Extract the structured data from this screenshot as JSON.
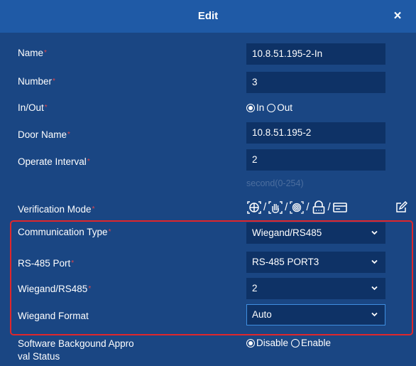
{
  "dialog": {
    "title": "Edit",
    "close_symbol": "×"
  },
  "fields": {
    "name": {
      "label": "Name",
      "required_mark": "*",
      "value": "10.8.51.195-2-In"
    },
    "number": {
      "label": "Number",
      "required_mark": "*",
      "value": "3"
    },
    "in_out": {
      "label": "In/Out",
      "required_mark": "*",
      "option_in": "In",
      "option_out": "Out",
      "selected": "In"
    },
    "door_name": {
      "label": "Door Name",
      "required_mark": "*",
      "value": "10.8.51.195-2"
    },
    "operate_interval": {
      "label": "Operate Interval",
      "required_mark": "*",
      "value": "2",
      "hint": "second(0-254)"
    },
    "verification_mode": {
      "label": "Verification Mode",
      "required_mark": "*",
      "separator": "/",
      "icons": [
        "face-icon",
        "palm-icon",
        "fingerprint-icon",
        "password-icon",
        "card-icon"
      ]
    },
    "communication_type": {
      "label": "Communication Type",
      "required_mark": "*",
      "value": "Wiegand/RS485"
    },
    "rs485_port": {
      "label": "RS-485 Port",
      "required_mark": "*",
      "value": "RS-485 PORT3"
    },
    "wiegand_rs485": {
      "label": "Wiegand/RS485",
      "required_mark": "*",
      "value": "2"
    },
    "wiegand_format": {
      "label": "Wiegand Format",
      "value": "Auto"
    },
    "software_background_approval": {
      "label_line1": "Software Backgound Appro",
      "label_line2": "val Status",
      "option_disable": "Disable",
      "option_enable": "Enable",
      "selected": "Disable"
    }
  },
  "colors": {
    "background": "#1a4683",
    "titlebar": "#1f5aa6",
    "field": "#0e3266",
    "required": "#e2454a",
    "highlight_border": "#e0262b",
    "focus_border": "#3f8ee0"
  }
}
